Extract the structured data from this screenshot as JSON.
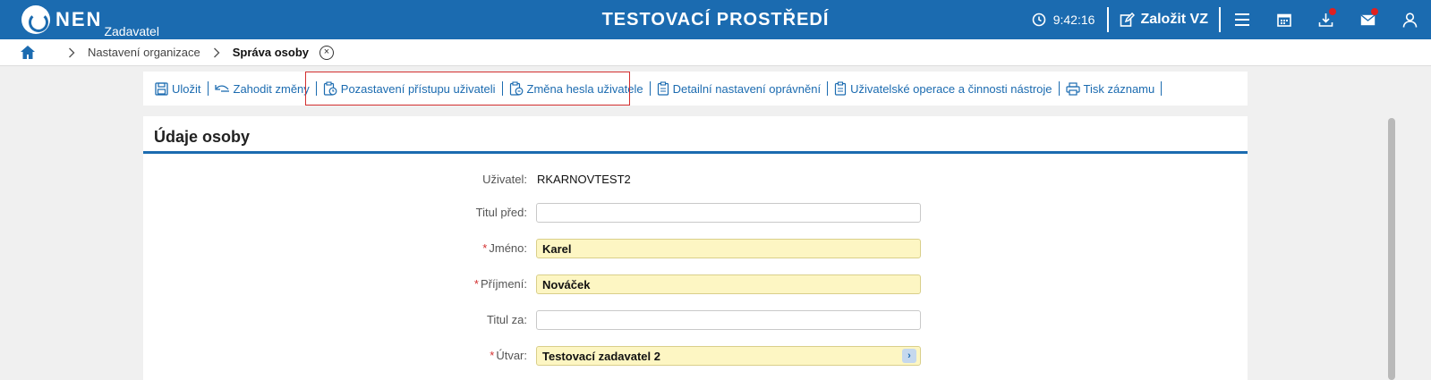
{
  "header": {
    "logo_text": "NEN",
    "logo_sub": "Zadavatel",
    "env_title": "TESTOVACÍ PROSTŘEDÍ",
    "time": "9:42:16",
    "create_label": "Založit VZ"
  },
  "breadcrumb": {
    "items": [
      "Nastavení organizace",
      "Správa osoby"
    ],
    "close_symbol": "×"
  },
  "toolbar": {
    "save": "Uložit",
    "discard": "Zahodit změny",
    "suspend_access": "Pozastavení přístupu uživateli",
    "change_password": "Změna hesla uživatele",
    "detail_permissions": "Detailní nastavení oprávnění",
    "user_operations": "Uživatelské operace a činnosti nástroje",
    "print": "Tisk záznamu"
  },
  "panel": {
    "title": "Údaje osoby",
    "fields": {
      "user": {
        "label": "Uživatel:",
        "value": "RKARNOVTEST2"
      },
      "title_before": {
        "label": "Titul před:",
        "value": ""
      },
      "first_name": {
        "label": "Jméno:",
        "value": "Karel",
        "required": "*"
      },
      "last_name": {
        "label": "Příjmení:",
        "value": "Nováček",
        "required": "*"
      },
      "title_after": {
        "label": "Titul za:",
        "value": ""
      },
      "department": {
        "label": "Útvar:",
        "value": "Testovací zadavatel 2",
        "required": "*",
        "picker": "›"
      }
    }
  },
  "colors": {
    "brand_blue": "#1b6bb0",
    "required_bg": "#fdf6c3",
    "highlight_red": "#d32f2f",
    "badge_red": "#e02020"
  }
}
